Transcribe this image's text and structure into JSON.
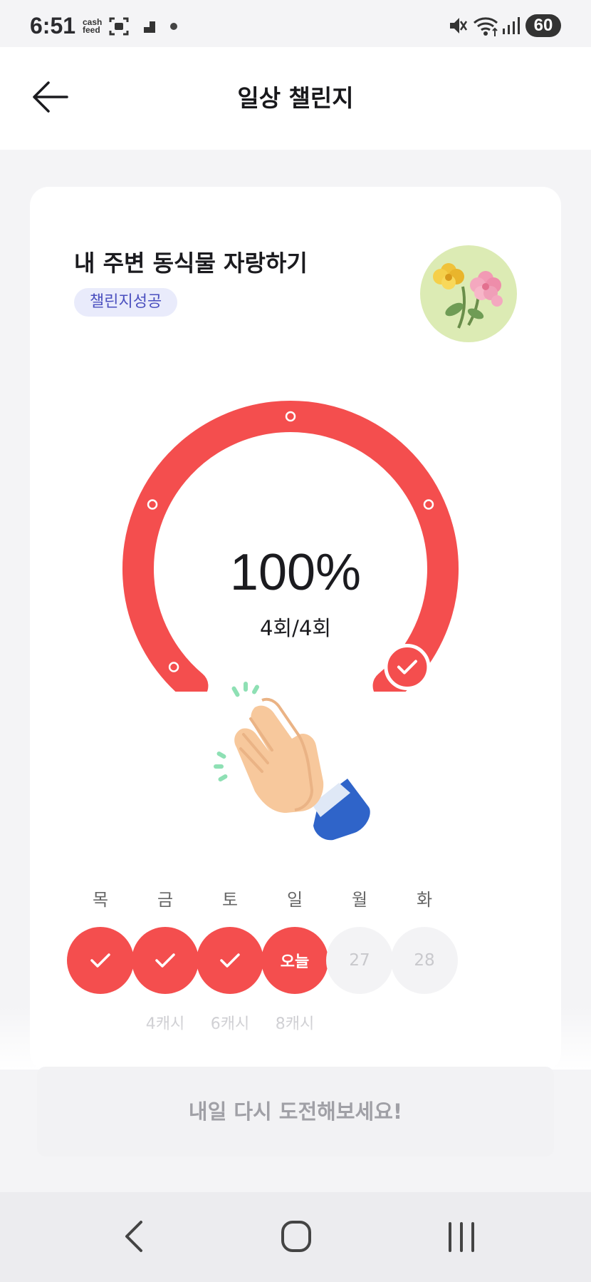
{
  "status_bar": {
    "time": "6:51",
    "app_badge": "cash feed",
    "battery": "60",
    "icons": [
      "cashfeed-icon",
      "screenshot-icon",
      "stairs-icon",
      "dot-icon",
      "mute-icon",
      "wifi-icon",
      "signal-icon",
      "battery-icon"
    ]
  },
  "header": {
    "title": "일상 챌린지",
    "back_icon": "arrow-left-icon"
  },
  "challenge": {
    "title": "내 주변 동식물 자랑하기",
    "badge": "챌린지성공",
    "image": "flowers-illustration"
  },
  "progress": {
    "percent_text": "100%",
    "count_text": "4회/4회",
    "fraction": 1.0,
    "checkpoints": 4,
    "completed": 4
  },
  "week": {
    "days": [
      {
        "label": "목",
        "state": "done",
        "text": "",
        "reward": ""
      },
      {
        "label": "금",
        "state": "done",
        "text": "",
        "reward": "4캐시"
      },
      {
        "label": "토",
        "state": "done",
        "text": "",
        "reward": "6캐시"
      },
      {
        "label": "일",
        "state": "today",
        "text": "오늘",
        "reward": "8캐시"
      },
      {
        "label": "월",
        "state": "future",
        "text": "27",
        "reward": ""
      },
      {
        "label": "화",
        "state": "future",
        "text": "28",
        "reward": ""
      }
    ]
  },
  "action": {
    "button_label": "내일 다시 도전해보세요!"
  },
  "colors": {
    "accent": "#f44e4e",
    "badge_bg": "#e9ebfb",
    "badge_text": "#4a4fbf"
  }
}
